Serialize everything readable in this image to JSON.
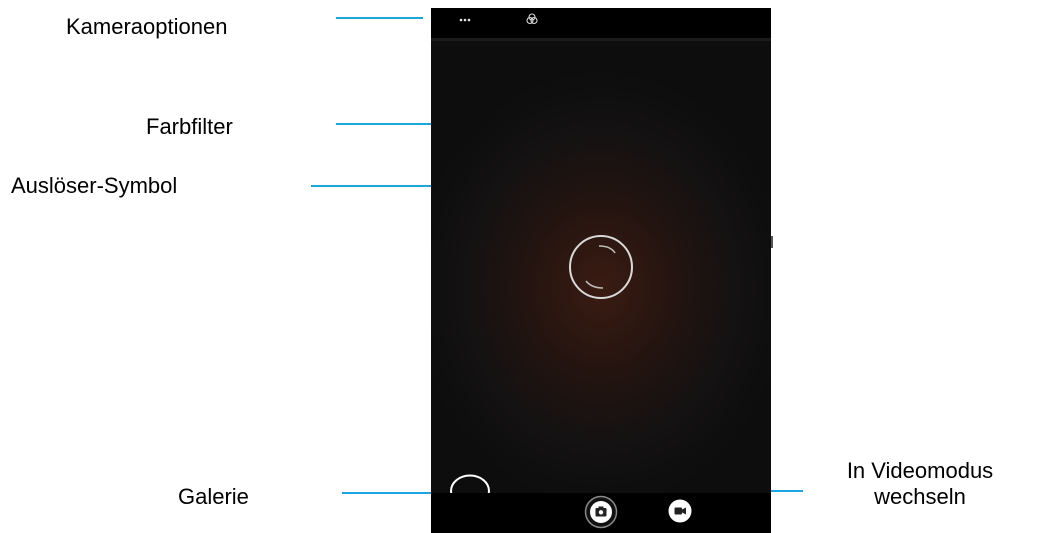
{
  "callouts": {
    "camera_options": "Kameraoptionen",
    "color_filter": "Farbfilter",
    "shutter_icon": "Auslöser-Symbol",
    "gallery": "Galerie",
    "switch_video_line1": "In Videomodus",
    "switch_video_line2": "wechseln"
  },
  "icons": {
    "more_options": "more-dots-icon",
    "color_filter": "filter-circles-icon",
    "focus_ring": "focus-ring-icon",
    "gallery_thumbnail": "gallery-circle-icon",
    "photo_mode": "camera-icon",
    "video_mode": "video-camera-icon"
  },
  "colors": {
    "callout_line": "#1aa7e0",
    "screen_background": "#0d0d0d",
    "accent_glow": "#3a1c12"
  }
}
